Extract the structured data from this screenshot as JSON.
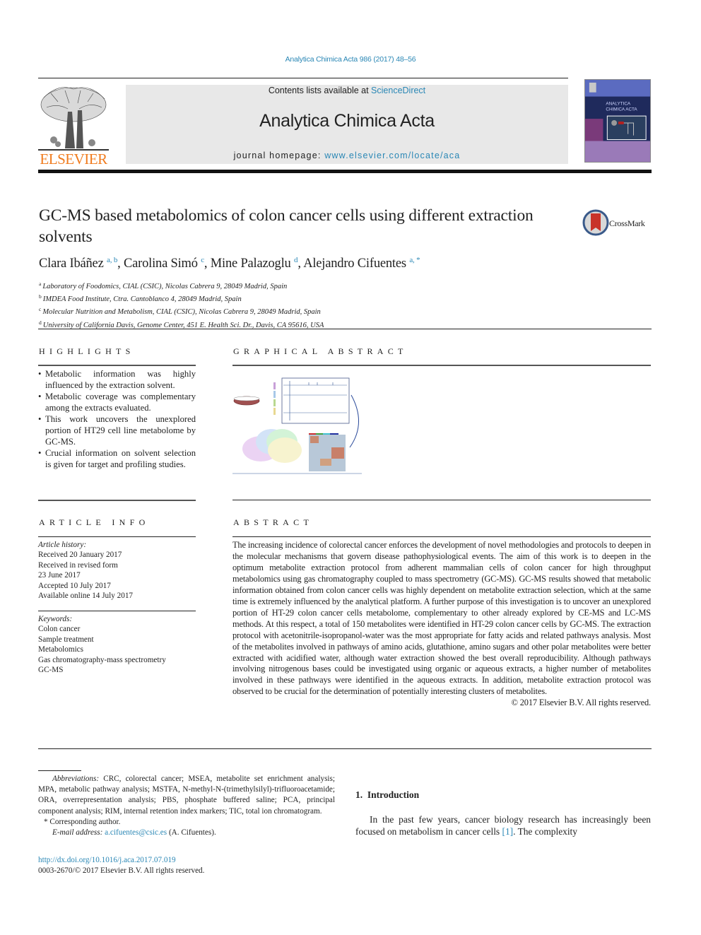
{
  "running_head": "Analytica Chimica Acta 986 (2017) 48–56",
  "masthead": {
    "publisher": "ELSEVIER",
    "contents_prefix": "Contents lists available at ",
    "contents_link": "ScienceDirect",
    "journal_title": "Analytica Chimica Acta",
    "homepage_prefix": "journal homepage: ",
    "homepage_link": "www.elsevier.com/locate/aca",
    "cover_title_line1": "ANALYTICA",
    "cover_title_line2": "CHIMICA ACTA"
  },
  "article": {
    "title": "GC-MS based metabolomics of colon cancer cells using different extraction solvents",
    "crossmark_label": "CrossMark",
    "authors": [
      {
        "name": "Clara Ibáñez",
        "affil": "a, b"
      },
      {
        "name": "Carolina Simó",
        "affil": "c"
      },
      {
        "name": "Mine Palazoglu",
        "affil": "d"
      },
      {
        "name": "Alejandro Cifuentes",
        "affil": "a, *"
      }
    ],
    "affiliations": [
      {
        "key": "a",
        "text": "Laboratory of Foodomics, CIAL (CSIC), Nicolas Cabrera 9, 28049 Madrid, Spain"
      },
      {
        "key": "b",
        "text": "IMDEA Food Institute, Ctra. Cantoblanco 4, 28049 Madrid, Spain"
      },
      {
        "key": "c",
        "text": "Molecular Nutrition and Metabolism, CIAL (CSIC), Nicolas Cabrera 9, 28049 Madrid, Spain"
      },
      {
        "key": "d",
        "text": "University of California Davis, Genome Center, 451 E. Health Sci. Dr., Davis, CA 95616, USA"
      }
    ]
  },
  "highlights": {
    "heading": "HIGHLIGHTS",
    "items": [
      "Metabolic information was highly influenced by the extraction solvent.",
      "Metabolic coverage was complementary among the extracts evaluated.",
      "This work uncovers the unexplored portion of HT29 cell line metabolome by GC-MS.",
      "Crucial information on solvent selection is given for target and profiling studies."
    ]
  },
  "graphical_abstract": {
    "heading": "GRAPHICAL ABSTRACT"
  },
  "article_info": {
    "heading": "ARTICLE INFO",
    "history_label": "Article history:",
    "history": [
      "Received 20 January 2017",
      "Received in revised form",
      "23 June 2017",
      "Accepted 10 July 2017",
      "Available online 14 July 2017"
    ],
    "keywords_label": "Keywords:",
    "keywords": [
      "Colon cancer",
      "Sample treatment",
      "Metabolomics",
      "Gas chromatography-mass spectrometry",
      "GC-MS"
    ]
  },
  "abstract": {
    "heading": "ABSTRACT",
    "text": "The increasing incidence of colorectal cancer enforces the development of novel methodologies and protocols to deepen in the molecular mechanisms that govern disease pathophysiological events. The aim of this work is to deepen in the optimum metabolite extraction protocol from adherent mammalian cells of colon cancer for high throughput metabolomics using gas chromatography coupled to mass spectrometry (GC-MS). GC-MS results showed that metabolic information obtained from colon cancer cells was highly dependent on metabolite extraction selection, which at the same time is extremely influenced by the analytical platform. A further purpose of this investigation is to uncover an unexplored portion of HT-29 colon cancer cells metabolome, complementary to other already explored by CE-MS and LC-MS methods. At this respect, a total of 150 metabolites were identified in HT-29 colon cancer cells by GC-MS. The extraction protocol with acetonitrile-isopropanol-water was the most appropriate for fatty acids and related pathways analysis. Most of the metabolites involved in pathways of amino acids, glutathione, amino sugars and other polar metabolites were better extracted with acidified water, although water extraction showed the best overall reproducibility. Although pathways involving nitrogenous bases could be investigated using organic or aqueous extracts, a higher number of metabolites involved in these pathways were identified in the aqueous extracts. In addition, metabolite extraction protocol was observed to be crucial for the determination of potentially interesting clusters of metabolites.",
    "copyright": "© 2017 Elsevier B.V. All rights reserved."
  },
  "footnotes": {
    "abbreviations_label": "Abbreviations:",
    "abbreviations_text": " CRC, colorectal cancer; MSEA, metabolite set enrichment analysis; MPA, metabolic pathway analysis; MSTFA, N-methyl-N-(trimethylsilyl)-trifluoroacetamide; ORA, overrepresentation analysis; PBS, phosphate buffered saline; PCA, principal component analysis; RIM, internal retention index markers; TIC, total ion chromatogram.",
    "corresponding": "* Corresponding author.",
    "email_label": "E-mail address:",
    "email": "a.cifuentes@csic.es",
    "email_suffix": " (A. Cifuentes).",
    "doi": "http://dx.doi.org/10.1016/j.aca.2017.07.019",
    "issn": "0003-2670/© 2017 Elsevier B.V. All rights reserved."
  },
  "introduction": {
    "heading": "1.  Introduction",
    "text_before_ref": "In the past few years, cancer biology research has increasingly been focused on metabolism in cancer cells ",
    "ref": "[1]",
    "text_after_ref": ". The complexity"
  }
}
